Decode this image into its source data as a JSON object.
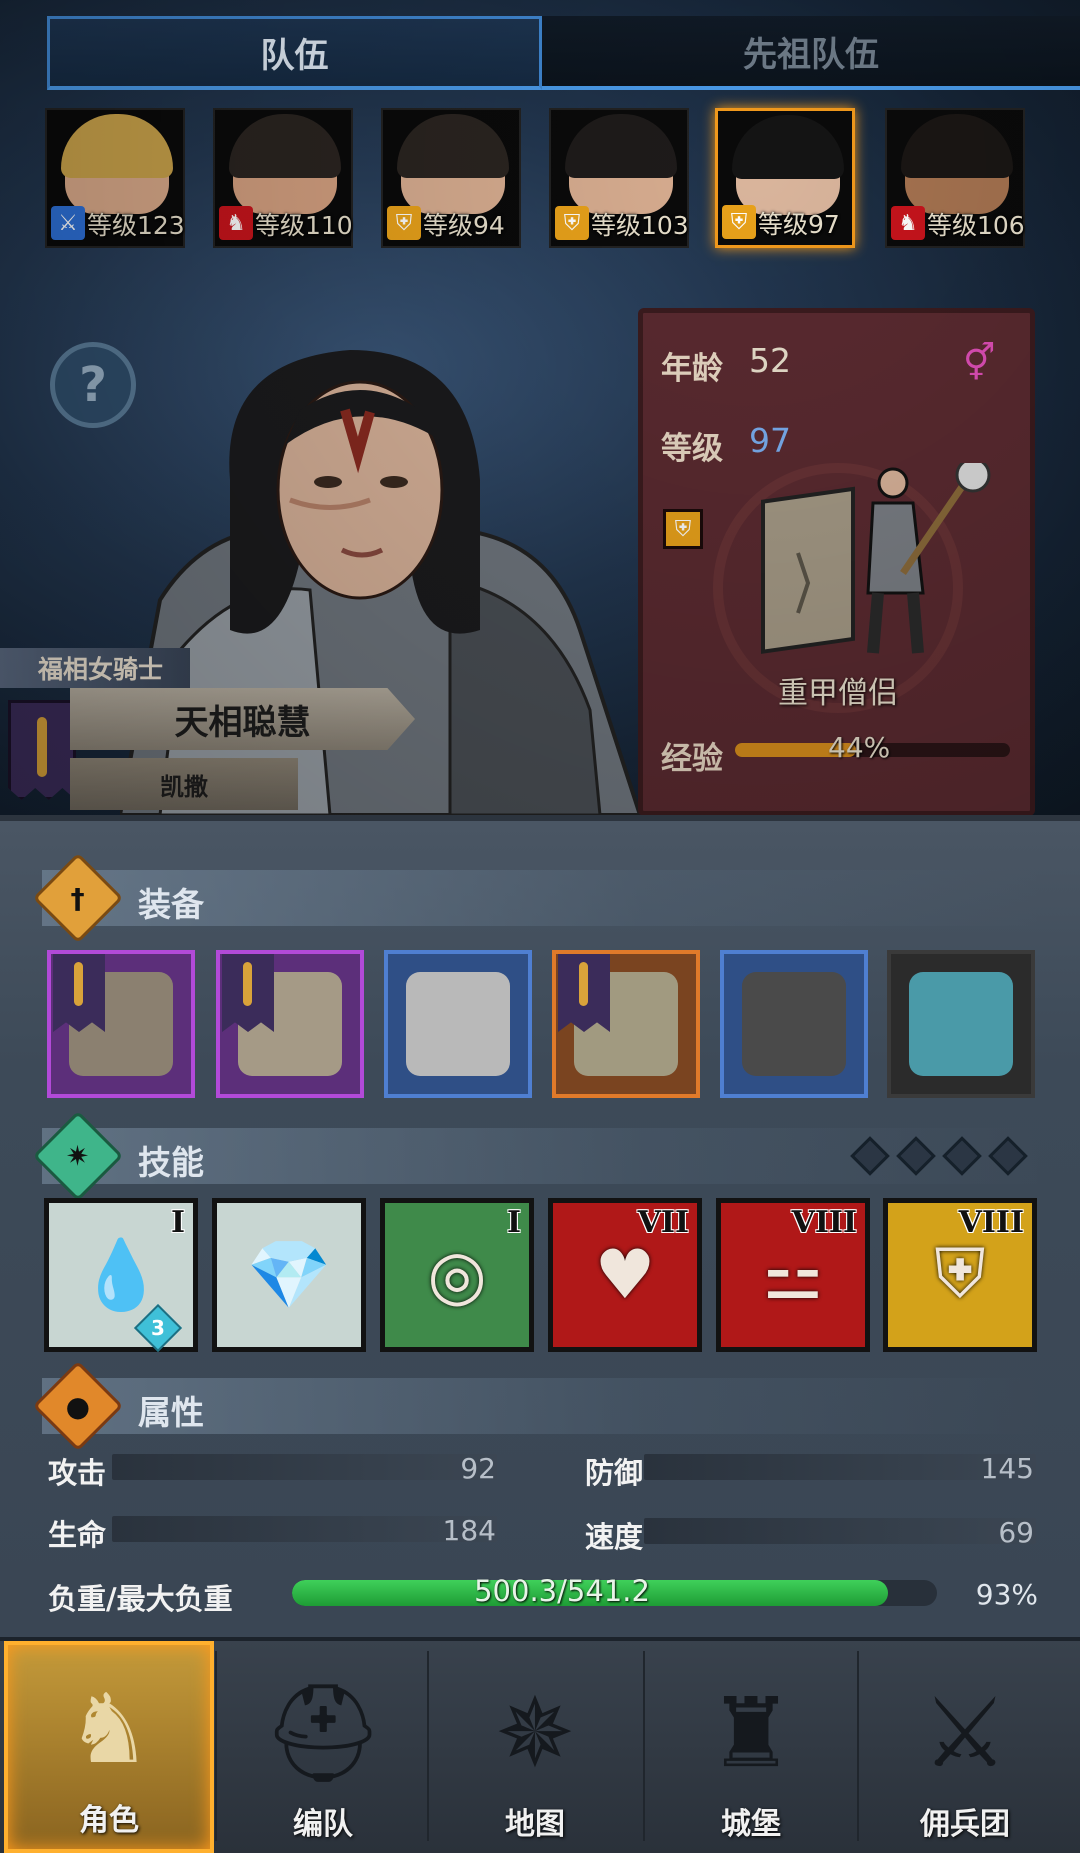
{
  "tabs": {
    "team": "队伍",
    "ancestor_team": "先祖队伍"
  },
  "heroes": [
    {
      "level_label": "等级123",
      "class_icon": "sword-icon",
      "badge_color": "#2d6fd6",
      "hair": "#c9a24a",
      "skin": "#d9a989"
    },
    {
      "level_label": "等级110",
      "class_icon": "beast-icon",
      "badge_color": "#c8141c",
      "hair": "#2a2420",
      "skin": "#d4a080"
    },
    {
      "level_label": "等级94",
      "class_icon": "shield-icon",
      "badge_color": "#e9a21a",
      "hair": "#2a2420",
      "skin": "#d8ad90"
    },
    {
      "level_label": "等级103",
      "class_icon": "shield-icon",
      "badge_color": "#e9a21a",
      "hair": "#1e1b1a",
      "skin": "#d8ad90"
    },
    {
      "level_label": "等级97",
      "class_icon": "shield-icon",
      "badge_color": "#e9a21a",
      "hair": "#141414",
      "skin": "#dab59c"
    },
    {
      "level_label": "等级106",
      "class_icon": "beast-icon",
      "badge_color": "#c8141c",
      "hair": "#1a1614",
      "skin": "#a67350"
    }
  ],
  "character": {
    "title": "福相女骑士",
    "name": "天相聪慧",
    "subname": "凯撒",
    "age_label": "年龄",
    "age": "52",
    "level_label": "等级",
    "level": "97",
    "gender_icon": "female-icon",
    "class_name": "重甲僧侣",
    "exp_label": "经验",
    "exp_text": "44%",
    "exp_fraction": 0.44
  },
  "sections": {
    "equipment": "装备",
    "skills": "技能",
    "attributes": "属性"
  },
  "equipment": [
    {
      "name": "mace-icon",
      "border": "#b24ad8",
      "bg": "#5c2f7a",
      "art": "#8b8070",
      "banner": true
    },
    {
      "name": "shield-icon",
      "border": "#b24ad8",
      "bg": "#5c2f7a",
      "art": "#a59a86",
      "banner": true
    },
    {
      "name": "helmet-icon",
      "border": "#4f7fd1",
      "bg": "#2f4f86",
      "art": "#b9b9b9",
      "banner": false
    },
    {
      "name": "armor-icon",
      "border": "#e07a2a",
      "bg": "#7a4420",
      "art": "#a19a80",
      "banner": true
    },
    {
      "name": "boots-icon",
      "border": "#4f7fd1",
      "bg": "#2f4f86",
      "art": "#4a4a4a",
      "banner": false
    },
    {
      "name": "amulet-icon",
      "border": "#3a3a3a",
      "bg": "#2b2b2b",
      "art": "#4a9aa8",
      "banner": false
    }
  ],
  "skills": [
    {
      "name": "skill-drain-icon",
      "roman": "I",
      "bg": "#c8d6d2",
      "glyph": "💧",
      "badge": "3"
    },
    {
      "name": "skill-crystal-icon",
      "roman": "",
      "bg": "#c8d6d2",
      "glyph": "💎",
      "badge": ""
    },
    {
      "name": "skill-target-icon",
      "roman": "I",
      "bg": "#3f8a4a",
      "glyph": "◎",
      "badge": ""
    },
    {
      "name": "skill-heart-icon",
      "roman": "VII",
      "bg": "#b01818",
      "glyph": "♥",
      "badge": ""
    },
    {
      "name": "skill-strength-icon",
      "roman": "VIII",
      "bg": "#b01818",
      "glyph": "⚍",
      "badge": ""
    },
    {
      "name": "skill-defense-icon",
      "roman": "VIII",
      "bg": "#d3a21a",
      "glyph": "⛨",
      "badge": ""
    }
  ],
  "attributes": {
    "attack_label": "攻击",
    "attack": "92",
    "defense_label": "防御",
    "defense": "145",
    "hp_label": "生命",
    "hp": "184",
    "speed_label": "速度",
    "speed": "69",
    "load_label": "负重/最大负重",
    "load_text": "500.3/541.2",
    "load_percent": "93%",
    "load_fraction": 0.924
  },
  "nav": [
    {
      "label": "角色",
      "icon": "knight-icon"
    },
    {
      "label": "编队",
      "icon": "helmet-icon"
    },
    {
      "label": "地图",
      "icon": "compass-icon"
    },
    {
      "label": "城堡",
      "icon": "castle-icon"
    },
    {
      "label": "佣兵团",
      "icon": "mercenary-icon"
    }
  ],
  "colors": {
    "accent": "#f39a1c",
    "tab_border": "#4a9ae8",
    "exp_bar": "#d98f1c",
    "load_bar": "#2dbd48"
  }
}
